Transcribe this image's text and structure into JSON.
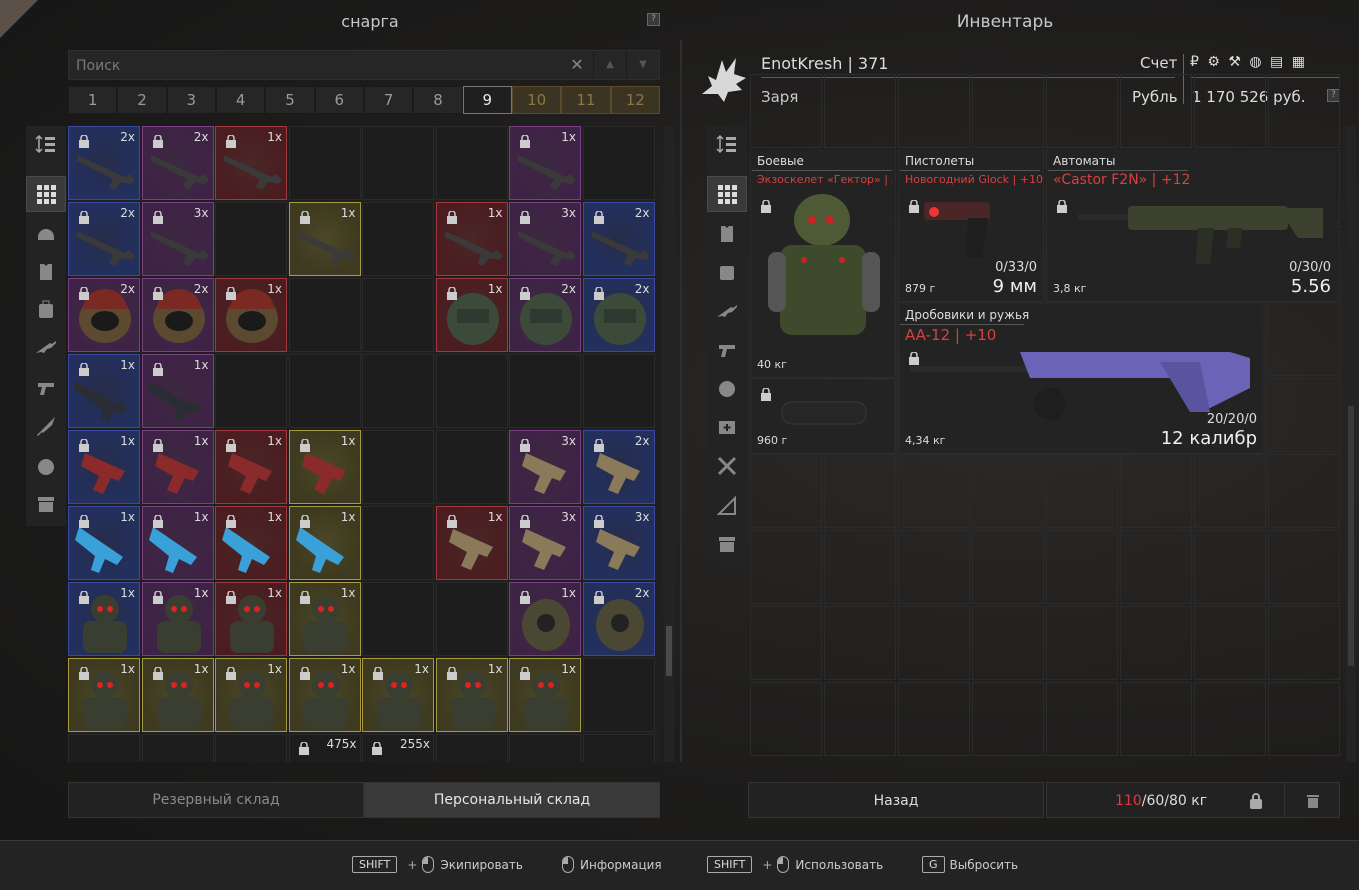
{
  "left_panel": {
    "title": "снарга",
    "help": "?",
    "search_placeholder": "Поиск",
    "clear": "✕",
    "up": "▲",
    "down": "▼",
    "pages": [
      "1",
      "2",
      "3",
      "4",
      "5",
      "6",
      "7",
      "8",
      "9",
      "10",
      "11",
      "12"
    ],
    "tabs": [
      "Резервный склад",
      "Персональный склад"
    ]
  },
  "right_panel": {
    "title": "Инвентарь",
    "player_name": "EnotKresh | 371",
    "faction": "Заря",
    "account_label": "Счет",
    "currency_label": "Рубль",
    "currencies": "₽ ⚙ ⚒ ◍ ▤ ▦",
    "money": "1 170 526 руб.",
    "help": "?"
  },
  "slots": {
    "combat": {
      "header": "Боевые",
      "name": "Экзоскелет «Гектор» | ...",
      "weight": "40 кг"
    },
    "pistol": {
      "header": "Пистолеты",
      "name": "Новогодний Glock | +10",
      "ammo": "0/33/0",
      "weight": "879 г",
      "caliber": "9 мм"
    },
    "rifle": {
      "header": "Автоматы",
      "name": "«Castor F2N» | +12",
      "ammo": "0/30/0",
      "weight": "3,8 кг",
      "caliber": "5.56"
    },
    "shotgun": {
      "header": "Дробовики и ружья",
      "name": "AA-12 | +10",
      "ammo": "20/20/0",
      "weight": "4,34 кг",
      "caliber": "12 калибр"
    },
    "extra": {
      "weight": "960 г"
    }
  },
  "footer": {
    "back": "Назад",
    "weight_current": "110",
    "weight_rest": "/60/80 кг"
  },
  "hints": [
    {
      "key": "SHIFT",
      "text": "Экипировать"
    },
    {
      "text": "Информация"
    },
    {
      "key": "SHIFT",
      "text": "Использовать"
    },
    {
      "key": "G",
      "text": "Выбросить"
    }
  ],
  "stash_counts": {
    "r0": [
      "2x",
      "2x",
      "1x",
      "",
      "",
      "",
      "1x",
      ""
    ],
    "r1": [
      "2x",
      "3x",
      "",
      "1x",
      "",
      "1x",
      "3x",
      "2x"
    ],
    "r2": [
      "2x",
      "2x",
      "1x",
      "",
      "",
      "1x",
      "2x",
      "2x"
    ],
    "r3": [
      "1x",
      "1x",
      "",
      "",
      "",
      "",
      "",
      ""
    ],
    "r4": [
      "1x",
      "1x",
      "1x",
      "1x",
      "",
      "",
      "3x",
      "2x"
    ],
    "r5": [
      "1x",
      "1x",
      "1x",
      "1x",
      "",
      "1x",
      "3x",
      "3x"
    ],
    "r6": [
      "1x",
      "1x",
      "1x",
      "1x",
      "",
      "",
      "1x",
      "2x"
    ],
    "r7": [
      "1x",
      "1x",
      "1x",
      "1x",
      "1x",
      "1x",
      "1x",
      ""
    ],
    "r8": [
      "",
      "",
      "",
      "475x",
      "255x",
      "",
      "",
      ""
    ]
  }
}
